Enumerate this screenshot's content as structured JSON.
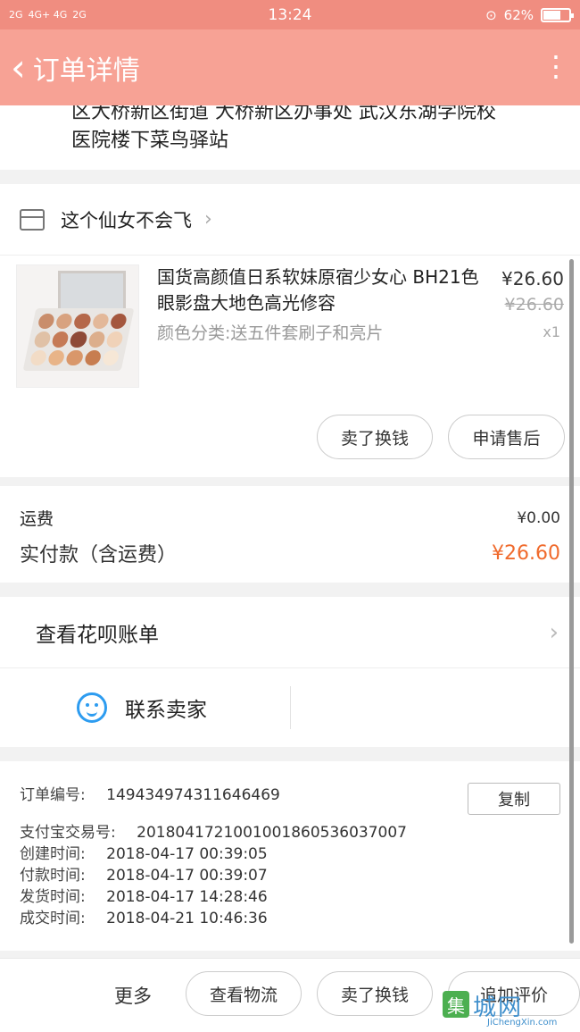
{
  "status_bar": {
    "signal_1": "2G",
    "signal_2": "4G+ 4G",
    "signal_3": "2G",
    "time": "13:24",
    "battery": "62%",
    "battery_level": 0.62
  },
  "header": {
    "title": "订单详情"
  },
  "address": {
    "line1": "区大桥新区街道 大桥新区办事处 武汉东湖学院校",
    "line2": "医院楼下菜鸟驿站"
  },
  "shop": {
    "name": "这个仙女不会飞"
  },
  "product": {
    "title": "国货高颜值日系软妹原宿少女心 BH21色眼影盘大地色高光修容",
    "spec": "颜色分类:送五件套刷子和亮片",
    "price": "¥26.60",
    "original_price": "¥26.60",
    "quantity": "x1",
    "buttons": {
      "sell": "卖了换钱",
      "after_sale": "申请售后"
    }
  },
  "fees": {
    "shipping_label": "运费",
    "shipping_value": "¥0.00",
    "paid_label": "实付款（含运费）",
    "paid_value": "¥26.60"
  },
  "bill": {
    "label": "查看花呗账单"
  },
  "contact": {
    "label": "联系卖家"
  },
  "order_info": {
    "order_no_label": "订单编号:",
    "order_no": "1494349743116464​69",
    "copy_button": "复制",
    "alipay_label": "支付宝交易号:",
    "alipay_no": "2018041721001001860536037007",
    "created_label": "创建时间:",
    "created": "2018-04-17 00:39:05",
    "paid_label": "付款时间:",
    "paid": "2018-04-17 00:39:07",
    "shipped_label": "发货时间:",
    "shipped": "2018-04-17 14:28:46",
    "done_label": "成交时间:",
    "done": "2018-04-21 10:46:36"
  },
  "footer": {
    "more": "更多",
    "logistics": "查看物流",
    "sell": "卖了换钱",
    "review": "追加评价"
  },
  "watermark": {
    "badge": "集",
    "text": "城网",
    "url": "JiChengXin.com"
  },
  "colors": {
    "header_bg": "#f7a295",
    "status_bg": "#f08d80",
    "price_accent": "#f06a2c",
    "contact_icon": "#2d9cf0"
  }
}
